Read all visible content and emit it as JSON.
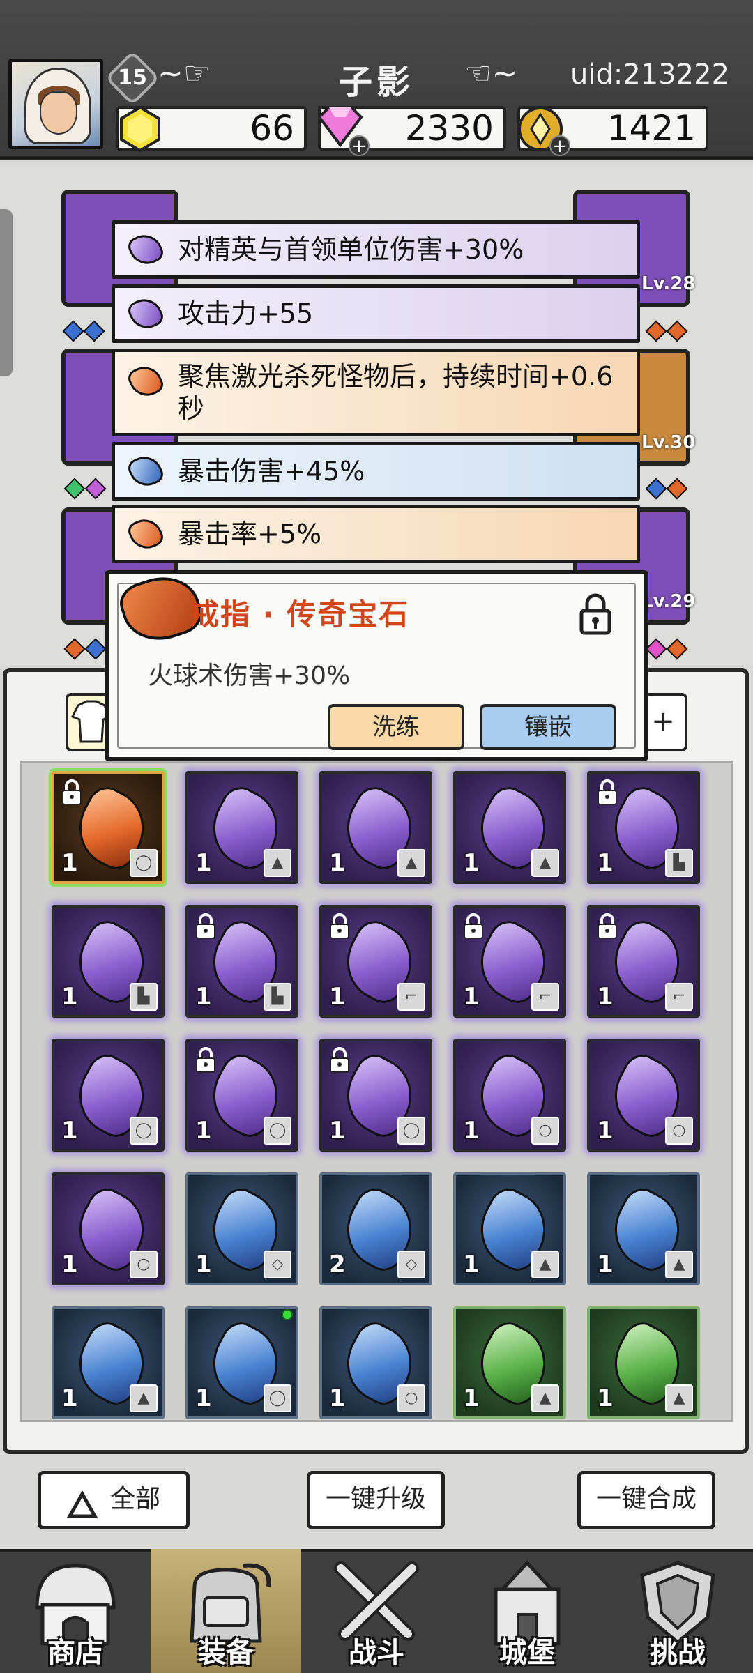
{
  "player": {
    "name": "子影",
    "level": "15",
    "uid": "uid:213222"
  },
  "resources": {
    "gold": "66",
    "diamond": "2330",
    "coin": "1421"
  },
  "equipment_levels": {
    "right_top": "Lv.28",
    "right_middle": "Lv.30",
    "right_bottom": "Lv.29"
  },
  "stats": [
    {
      "text": "对精英与首领单位伤害+30%",
      "rarity": "purple"
    },
    {
      "text": "攻击力+55",
      "rarity": "purple"
    },
    {
      "text": "聚焦激光杀死怪物后，持续时间+0.6秒",
      "rarity": "orange"
    },
    {
      "text": "暴击伤害+45%",
      "rarity": "blue"
    },
    {
      "text": "暴击率+5%",
      "rarity": "orange"
    }
  ],
  "gem_detail": {
    "title": "戒指 · 传奇宝石",
    "description": "火球术伤害+30%",
    "reroll_label": "洗练",
    "inlay_label": "镶嵌"
  },
  "colors": {
    "purple": "#7e4fb8",
    "orange": "#e46a2c",
    "blue": "#4b84d2",
    "green": "#5cb24b",
    "title_red": "#d0451a"
  },
  "gems": [
    {
      "rarity": "orange",
      "count": "1",
      "slot": "ring",
      "locked": true
    },
    {
      "rarity": "purple",
      "count": "1",
      "slot": "armor",
      "locked": false
    },
    {
      "rarity": "purple",
      "count": "1",
      "slot": "armor",
      "locked": false
    },
    {
      "rarity": "purple",
      "count": "1",
      "slot": "armor",
      "locked": false
    },
    {
      "rarity": "purple",
      "count": "1",
      "slot": "boots",
      "locked": true
    },
    {
      "rarity": "purple",
      "count": "1",
      "slot": "boots",
      "locked": false
    },
    {
      "rarity": "purple",
      "count": "1",
      "slot": "boots",
      "locked": true
    },
    {
      "rarity": "purple",
      "count": "1",
      "slot": "weapon",
      "locked": true
    },
    {
      "rarity": "purple",
      "count": "1",
      "slot": "weapon",
      "locked": true
    },
    {
      "rarity": "purple",
      "count": "1",
      "slot": "weapon",
      "locked": true
    },
    {
      "rarity": "purple",
      "count": "1",
      "slot": "ring",
      "locked": false
    },
    {
      "rarity": "purple",
      "count": "1",
      "slot": "ring",
      "locked": true
    },
    {
      "rarity": "purple",
      "count": "1",
      "slot": "ring",
      "locked": true
    },
    {
      "rarity": "purple",
      "count": "1",
      "slot": "necklace",
      "locked": false
    },
    {
      "rarity": "purple",
      "count": "1",
      "slot": "necklace",
      "locked": false
    },
    {
      "rarity": "purple",
      "count": "1",
      "slot": "necklace",
      "locked": false
    },
    {
      "rarity": "blue",
      "count": "1",
      "slot": "helmet",
      "locked": false
    },
    {
      "rarity": "blue",
      "count": "2",
      "slot": "helmet",
      "locked": false
    },
    {
      "rarity": "blue",
      "count": "1",
      "slot": "armor",
      "locked": false
    },
    {
      "rarity": "blue",
      "count": "1",
      "slot": "armor",
      "locked": false
    },
    {
      "rarity": "blue",
      "count": "1",
      "slot": "armor",
      "locked": false
    },
    {
      "rarity": "blue",
      "count": "1",
      "slot": "ring",
      "locked": false,
      "new": true
    },
    {
      "rarity": "blue",
      "count": "1",
      "slot": "necklace",
      "locked": false
    },
    {
      "rarity": "green",
      "count": "1",
      "slot": "armor",
      "locked": false
    },
    {
      "rarity": "green",
      "count": "1",
      "slot": "armor",
      "locked": false
    }
  ],
  "actions": {
    "all_label": "全部",
    "upgrade_all_label": "一键升级",
    "merge_all_label": "一键合成",
    "plus_label": "+"
  },
  "nav": [
    {
      "label": "商店",
      "icon": "shop-icon",
      "active": false
    },
    {
      "label": "装备",
      "icon": "backpack-icon",
      "active": true
    },
    {
      "label": "战斗",
      "icon": "crossed-swords-icon",
      "active": false
    },
    {
      "label": "城堡",
      "icon": "castle-icon",
      "active": false
    },
    {
      "label": "挑战",
      "icon": "shield-icon",
      "active": false
    }
  ]
}
